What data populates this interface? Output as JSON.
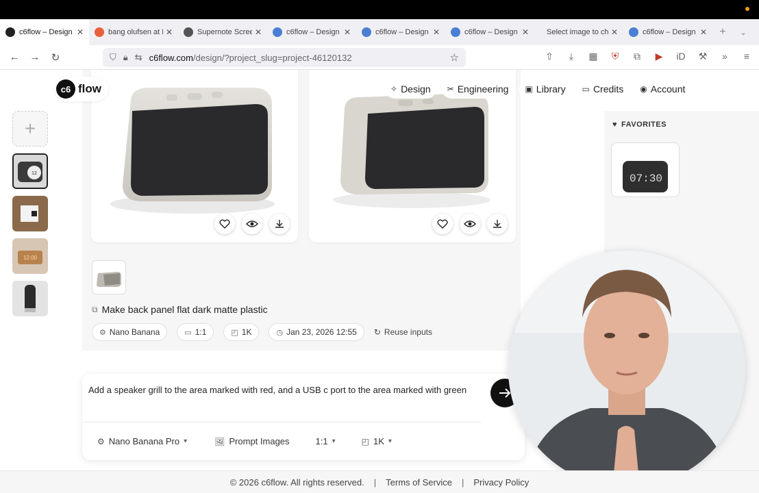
{
  "browser": {
    "tabs": [
      {
        "title": "c6flow – Design",
        "active": true,
        "favicon_color": "#222222"
      },
      {
        "title": "bang olufsen at D",
        "active": false,
        "favicon_color": "#e8613a"
      },
      {
        "title": "Supernote Screen",
        "active": false,
        "favicon_color": "#555555"
      },
      {
        "title": "c6flow – Design",
        "active": false,
        "favicon_color": "#4a7fd4"
      },
      {
        "title": "c6flow – Design",
        "active": false,
        "favicon_color": "#4a7fd4"
      },
      {
        "title": "c6flow – Design",
        "active": false,
        "favicon_color": "#4a7fd4"
      },
      {
        "title": "Select image to chan",
        "active": false,
        "favicon_color": ""
      },
      {
        "title": "c6flow – Design",
        "active": false,
        "favicon_color": "#4a7fd4"
      }
    ],
    "url_host": "c6flow.com",
    "url_path": "/design/?project_slug=project-46120132"
  },
  "app": {
    "logo_text": "flow",
    "logo_mark": "c6",
    "nav": [
      {
        "label": "Design",
        "icon": "sparkle-icon"
      },
      {
        "label": "Engineering",
        "icon": "tools-icon"
      },
      {
        "label": "Library",
        "icon": "image-icon"
      },
      {
        "label": "Credits",
        "icon": "card-icon"
      },
      {
        "label": "Account",
        "icon": "user-icon"
      }
    ],
    "prompt_title": "Make back panel flat dark matte plastic",
    "chips": {
      "model": "Nano Banana",
      "ratio": "1:1",
      "resolution": "1K",
      "date": "Jan 23, 2026 12:55",
      "reuse": "Reuse inputs"
    },
    "composer": {
      "text": "Add a speaker grill to the area marked with red, and a USB c port to the area marked with green",
      "model": "Nano Banana Pro",
      "prompt_images": "Prompt Images",
      "ratio": "1:1",
      "resolution": "1K"
    },
    "favorites": {
      "header": "FAVORITES"
    },
    "footer": {
      "copyright": "© 2026 c6flow. All rights reserved.",
      "terms": "Terms of Service",
      "privacy": "Privacy Policy"
    }
  },
  "colors": {
    "accent": "#111111",
    "panel_bg": "#f6f6f7",
    "device_grey": "#d8d6d0",
    "device_front": "#2a2a2c"
  }
}
